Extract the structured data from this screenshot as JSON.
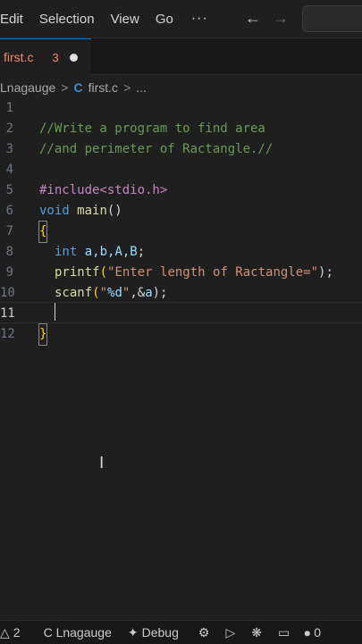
{
  "menu": {
    "items": [
      "Edit",
      "Selection",
      "View",
      "Go"
    ],
    "more": "···",
    "back_icon": "←",
    "forward_icon": "→"
  },
  "tab": {
    "filename": "first.c",
    "problems": "3",
    "modified": true
  },
  "breadcrumb": {
    "folder": "Lnagauge",
    "sep": ">",
    "file_icon": "C",
    "file": "first.c",
    "more": "..."
  },
  "editor": {
    "lines": [
      {
        "num": "1"
      },
      {
        "num": "2"
      },
      {
        "num": "3"
      },
      {
        "num": "4"
      },
      {
        "num": "5"
      },
      {
        "num": "6"
      },
      {
        "num": "7"
      },
      {
        "num": "8"
      },
      {
        "num": "9"
      },
      {
        "num": "10"
      },
      {
        "num": "11"
      },
      {
        "num": "12"
      }
    ],
    "code": {
      "l2": "//Write a program to find area",
      "l3": "//and perimeter of Ractangle.//",
      "l5": "#include<stdio.h>",
      "l6_kw": "void",
      "l6_fn": "main",
      "l6_rest": "()",
      "l7": "{",
      "l8_kw": "int",
      "l8_vars": "a,b,A,B",
      "l8_end": ";",
      "l9_fn": "printf",
      "l9_open": "(",
      "l9_str": "\"Enter length of Ractangle=\"",
      "l9_end": ");",
      "l10_fn": "scanf",
      "l10_open": "(",
      "l10_str1": "\"",
      "l10_fmt": "%d",
      "l10_str2": "\"",
      "l10_mid": ",&",
      "l10_var": "a",
      "l10_end": ");",
      "l12": "}"
    }
  },
  "status": {
    "problems": "2",
    "problems_icon": "warning-icon",
    "folder": "C Lnagauge",
    "debug": "Debug",
    "ports": "0",
    "colors": {
      "background": "#181818",
      "accent": "#0078d4"
    }
  }
}
